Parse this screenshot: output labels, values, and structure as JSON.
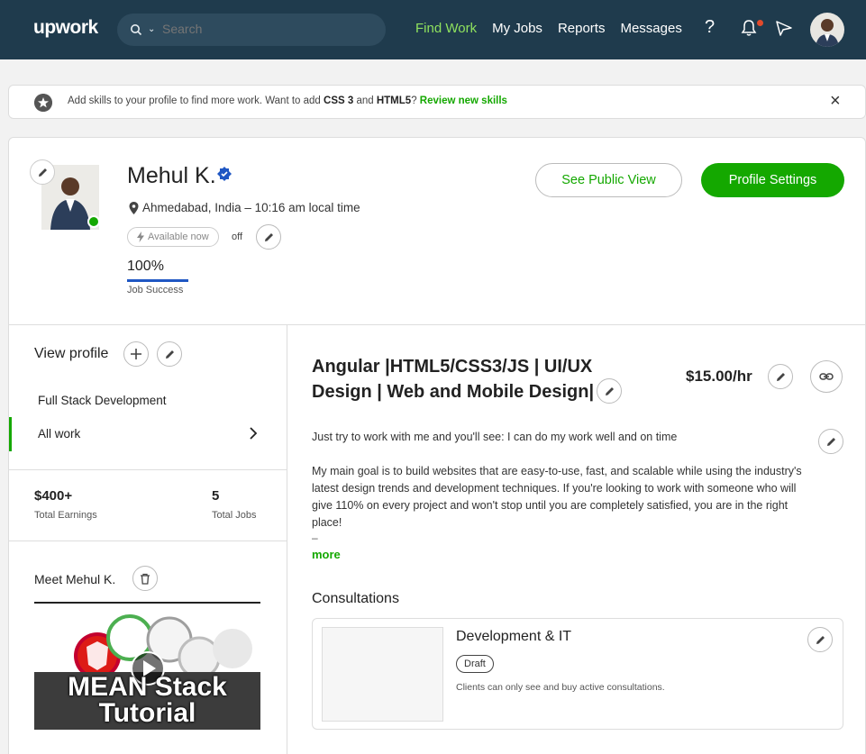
{
  "nav": {
    "logo": "upwork",
    "search_placeholder": "Search",
    "links": [
      "Find Work",
      "My Jobs",
      "Reports",
      "Messages"
    ],
    "active_link": "Find Work",
    "help_glyph": "?"
  },
  "banner": {
    "text_before": "Add skills to your profile to find more work. Want to add ",
    "skill1": "CSS 3",
    "and": " and ",
    "skill2": "HTML5",
    "question": "? ",
    "link": "Review new skills",
    "close": "×"
  },
  "profile": {
    "name": "Mehul K.",
    "location": "Ahmedabad, India – 10:16 am local time",
    "availability": "Available now",
    "availability_state": "off",
    "job_success_value": "100%",
    "job_success_label": "Job Success",
    "see_public_view": "See Public View",
    "profile_settings": "Profile Settings"
  },
  "left": {
    "view_profile": "View profile",
    "specialized": "Full Stack Development",
    "all_work": "All work",
    "earnings_value": "$400+",
    "earnings_label": "Total Earnings",
    "jobs_value": "5",
    "jobs_label": "Total Jobs",
    "meet": "Meet Mehul K.",
    "video_line1": "MEAN Stack",
    "video_line2": "Tutorial"
  },
  "right": {
    "title": "Angular |HTML5/CSS3/JS | UI/UX Design | Web and Mobile Design|",
    "rate": "$15.00/hr",
    "overview_line1": "Just try to work with me and you'll see: I can do my work well and on time",
    "overview_para": "My main goal is to build websites that are easy-to-use, fast, and scalable while using the industry's latest design trends and development techniques. If you're looking to work with someone who will give 110% on every project and won't stop until you are completely satisfied, you are in the right place!",
    "overview_dash": "–",
    "more": "more",
    "consultations_heading": "Consultations",
    "consultation": {
      "title": "Development & IT",
      "status": "Draft",
      "note": "Clients can only see and buy active consultations."
    }
  },
  "colors": {
    "nav_bg": "#1f3b4d",
    "brand_green": "#14a800",
    "active_nav": "#8fe25e",
    "job_success_bar": "#1f57c3",
    "online": "#14a800",
    "verified": "#1f57c3",
    "notification_dot": "#e24a2b"
  },
  "icons": [
    "search-icon",
    "chevron-down-icon",
    "help-icon",
    "bell-icon",
    "send-icon",
    "star-icon",
    "close-icon",
    "pencil-icon",
    "verified-badge-icon",
    "location-pin-icon",
    "bolt-icon",
    "plus-icon",
    "chevron-right-icon",
    "trash-icon",
    "link-icon",
    "play-icon"
  ]
}
